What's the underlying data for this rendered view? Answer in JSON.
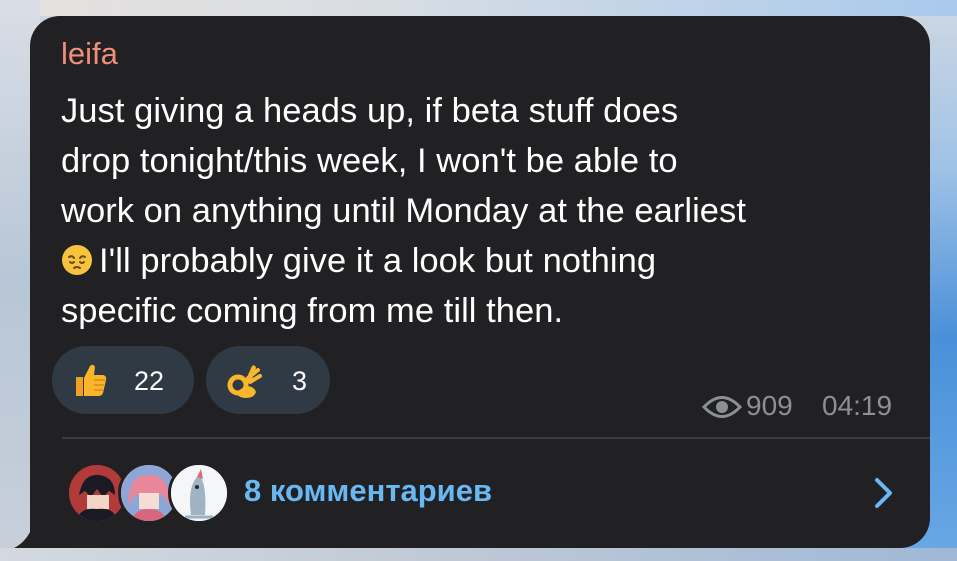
{
  "post": {
    "author": "leifa",
    "text_line1": "Just giving a heads up, if beta stuff does",
    "text_line2": "drop tonight/this week, I won't be able to",
    "text_line3": "work on anything until Monday at the earliest",
    "text_line4": "I'll probably give it a look but nothing",
    "text_line5": "specific coming from me till then.",
    "inline_emoji": "pensive-face-emoji"
  },
  "reactions": [
    {
      "emoji": "thumbs-up-emoji",
      "count": "22"
    },
    {
      "emoji": "ok-hand-emoji",
      "count": "3"
    }
  ],
  "meta": {
    "views": "909",
    "time": "04:19"
  },
  "comments": {
    "label": "8 комментариев"
  },
  "colors": {
    "bubble_bg": "#212124",
    "author": "#ef8f7a",
    "link": "#6ab8f3",
    "meta": "#8c8f94",
    "reaction_bg": "#2f3a45"
  }
}
